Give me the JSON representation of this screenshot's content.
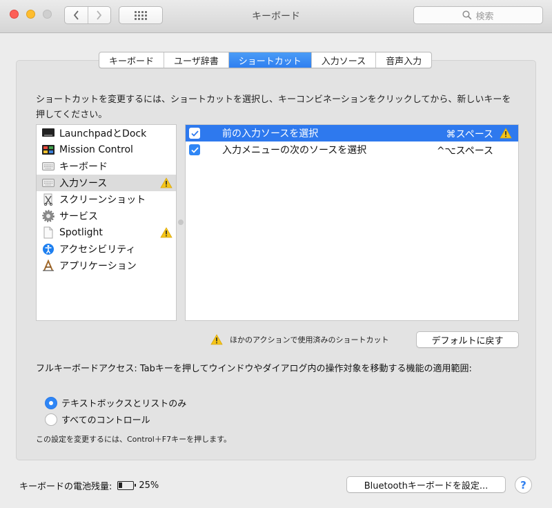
{
  "window": {
    "title": "キーボード"
  },
  "toolbar": {
    "search_placeholder": "検索"
  },
  "tabs": [
    {
      "label": "キーボード"
    },
    {
      "label": "ユーザ辞書"
    },
    {
      "label": "ショートカット",
      "active": true
    },
    {
      "label": "入力ソース"
    },
    {
      "label": "音声入力"
    }
  ],
  "description": "ショートカットを変更するには、ショートカットを選択し、キーコンビネーションをクリックしてから、新しいキーを押してください。",
  "categories": [
    {
      "label": "LaunchpadとDock",
      "icon": "launchpad-icon"
    },
    {
      "label": "Mission Control",
      "icon": "mission-control-icon"
    },
    {
      "label": "キーボード",
      "icon": "keyboard-icon"
    },
    {
      "label": "入力ソース",
      "icon": "keyboard-icon",
      "selected": true,
      "warning": true
    },
    {
      "label": "スクリーンショット",
      "icon": "screenshot-icon"
    },
    {
      "label": "サービス",
      "icon": "gear-icon"
    },
    {
      "label": "Spotlight",
      "icon": "document-icon",
      "warning": true
    },
    {
      "label": "アクセシビリティ",
      "icon": "accessibility-icon"
    },
    {
      "label": "アプリケーション",
      "icon": "app-icon"
    }
  ],
  "shortcuts": [
    {
      "label": "前の入力ソースを選択",
      "key": "⌘スペース",
      "checked": true,
      "selected": true,
      "warning": true
    },
    {
      "label": "入力メニューの次のソースを選択",
      "key": "^⌥スペース",
      "checked": true
    }
  ],
  "legend": "ほかのアクションで使用済みのショートカット",
  "restore_default_button": "デフォルトに戻す",
  "full_keyboard_access": {
    "text": "フルキーボードアクセス: Tabキーを押してウインドウやダイアログ内の操作対象を移動する機能の適用範囲:",
    "options": [
      {
        "label": "テキストボックスとリストのみ",
        "selected": true
      },
      {
        "label": "すべてのコントロール"
      }
    ],
    "hint": "この設定を変更するには、Control＋F7キーを押します。"
  },
  "footer": {
    "battery_label": "キーボードの電池残量:",
    "battery_percent": "25%",
    "battery_level": 0.25,
    "bluetooth_button": "Bluetoothキーボードを設定...",
    "help_label": "?"
  },
  "colors": {
    "accent": "#2e79ee",
    "warning": "#f5c518"
  }
}
